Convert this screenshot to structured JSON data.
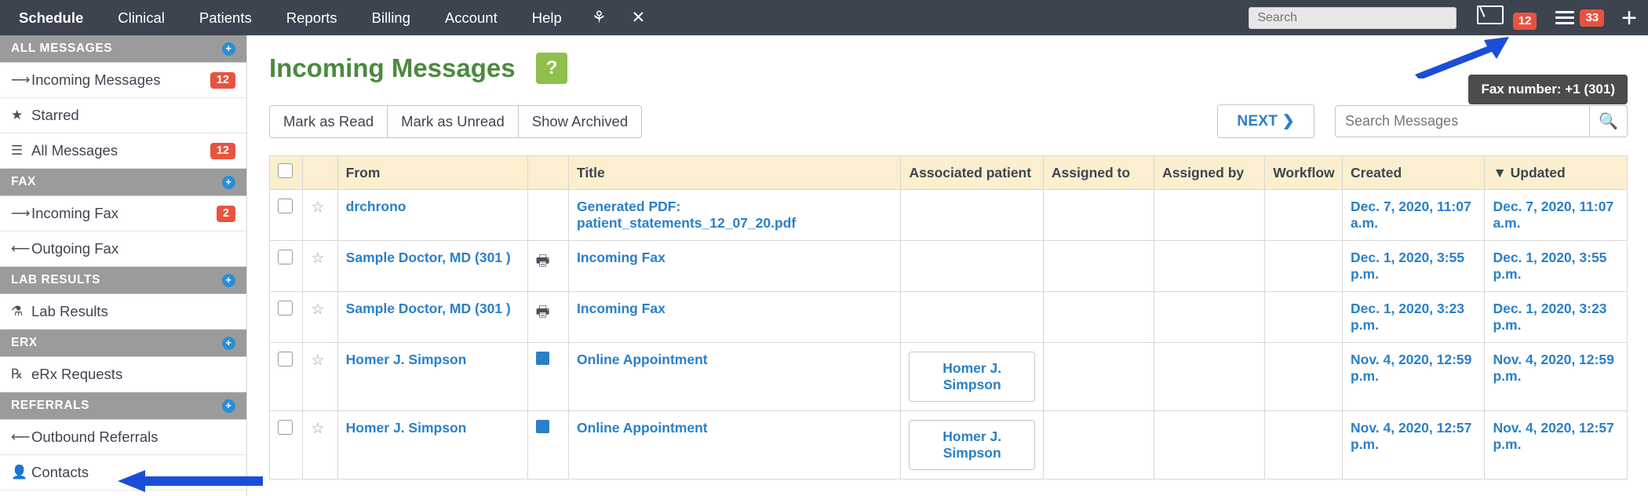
{
  "topnav": {
    "items": [
      "Schedule",
      "Clinical",
      "Patients",
      "Reports",
      "Billing",
      "Account",
      "Help"
    ],
    "icons": [
      "stethoscope-icon",
      "close-icon"
    ],
    "search_placeholder": "Search",
    "envelope_badge": "12",
    "menu_badge": "33",
    "accent_dark": "#3d4450",
    "badge_color": "#e8533f"
  },
  "sidebar": {
    "sections": [
      {
        "header": "ALL MESSAGES",
        "items": [
          {
            "icon": "arrow-right-icon",
            "label": "Incoming Messages",
            "count": "12"
          },
          {
            "icon": "star-icon",
            "label": "Starred",
            "count": ""
          },
          {
            "icon": "list-icon",
            "label": "All Messages",
            "count": "12"
          }
        ]
      },
      {
        "header": "FAX",
        "items": [
          {
            "icon": "arrow-right-icon",
            "label": "Incoming Fax",
            "count": "2"
          },
          {
            "icon": "arrow-left-icon",
            "label": "Outgoing Fax",
            "count": ""
          }
        ]
      },
      {
        "header": "LAB RESULTS",
        "items": [
          {
            "icon": "flask-icon",
            "label": "Lab Results",
            "count": ""
          }
        ]
      },
      {
        "header": "ERX",
        "items": [
          {
            "icon": "prescription-icon",
            "label": "eRx Requests",
            "count": ""
          }
        ]
      },
      {
        "header": "REFERRALS",
        "items": [
          {
            "icon": "arrow-left-icon",
            "label": "Outbound Referrals",
            "count": ""
          },
          {
            "icon": "contact-icon",
            "label": "Contacts",
            "count": ""
          }
        ]
      }
    ]
  },
  "main": {
    "title": "Incoming Messages",
    "help_label": "?",
    "buttons": [
      "Mark as Read",
      "Mark as Unread",
      "Show Archived"
    ],
    "next_label": "NEXT ❯",
    "search_messages_placeholder": "Search Messages",
    "search_icon": "magnifier-icon",
    "tooltip": "Fax number: +1 (301)",
    "table": {
      "columns": [
        "",
        "",
        "From",
        "",
        "Title",
        "Associated patient",
        "Assigned to",
        "Assigned by",
        "Workflow",
        "Created",
        "▼ Updated"
      ],
      "rows": [
        {
          "from": "drchrono",
          "icon": "",
          "title": "Generated PDF: patient_statements_12_07_20.pdf",
          "patient": "",
          "assigned_to": "",
          "assigned_by": "",
          "workflow": "",
          "created": "Dec. 7, 2020, 11:07 a.m.",
          "updated": "Dec. 7, 2020, 11:07 a.m."
        },
        {
          "from": "Sample Doctor, MD (301          )",
          "icon": "printer-icon",
          "title": "Incoming Fax",
          "patient": "",
          "assigned_to": "",
          "assigned_by": "",
          "workflow": "",
          "created": "Dec. 1, 2020, 3:55 p.m.",
          "updated": "Dec. 1, 2020, 3:55 p.m."
        },
        {
          "from": "Sample Doctor, MD (301          )",
          "icon": "printer-icon",
          "title": "Incoming Fax",
          "patient": "",
          "assigned_to": "",
          "assigned_by": "",
          "workflow": "",
          "created": "Dec. 1, 2020, 3:23 p.m.",
          "updated": "Dec. 1, 2020, 3:23 p.m."
        },
        {
          "from": "Homer J. Simpson",
          "icon": "blue-square-icon",
          "title": "Online Appointment",
          "patient": "Homer J. Simpson",
          "assigned_to": "",
          "assigned_by": "",
          "workflow": "",
          "created": "Nov. 4, 2020, 12:59 p.m.",
          "updated": "Nov. 4, 2020, 12:59 p.m."
        },
        {
          "from": "Homer J. Simpson",
          "icon": "blue-square-icon",
          "title": "Online Appointment",
          "patient": "Homer J. Simpson",
          "assigned_to": "",
          "assigned_by": "",
          "workflow": "",
          "created": "Nov. 4, 2020, 12:57 p.m.",
          "updated": "Nov. 4, 2020, 12:57 p.m."
        }
      ]
    }
  }
}
